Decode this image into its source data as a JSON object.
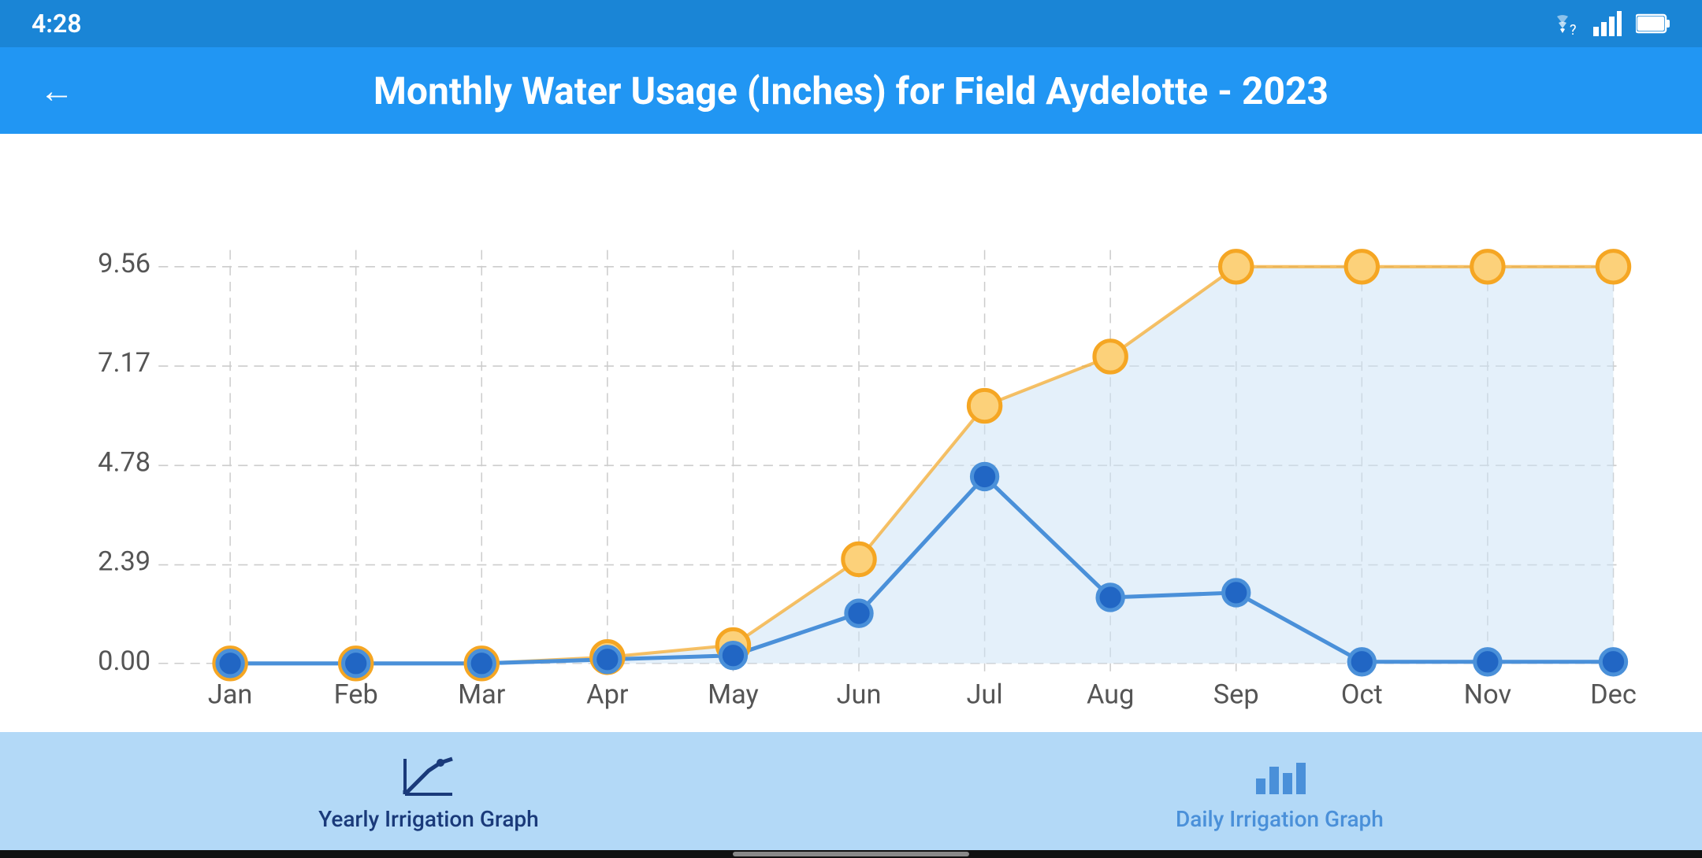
{
  "statusBar": {
    "time": "4:28",
    "icons": [
      "wifi",
      "signal",
      "battery"
    ]
  },
  "topBar": {
    "backLabel": "←",
    "title": "Monthly Water Usage (Inches) for Field Aydelotte - 2023"
  },
  "chart": {
    "yLabels": [
      "0.00",
      "2.39",
      "4.78",
      "7.17",
      "9.56"
    ],
    "xLabels": [
      "Jan",
      "Feb",
      "Mar",
      "Apr",
      "May",
      "Jun",
      "Jul",
      "Aug",
      "Sep",
      "Oct",
      "Nov",
      "Dec"
    ],
    "orangeData": [
      0.0,
      0.0,
      0.0,
      0.15,
      0.45,
      2.5,
      6.2,
      7.4,
      9.56,
      9.56,
      9.56,
      9.56
    ],
    "blueData": [
      0.0,
      0.0,
      0.0,
      0.1,
      0.2,
      1.2,
      4.5,
      1.6,
      1.7,
      0.05,
      0.05,
      0.05
    ]
  },
  "bottomNav": {
    "items": [
      {
        "id": "yearly",
        "label": "Yearly Irrigation Graph",
        "state": "active"
      },
      {
        "id": "daily",
        "label": "Daily Irrigation Graph",
        "state": "inactive"
      }
    ]
  }
}
